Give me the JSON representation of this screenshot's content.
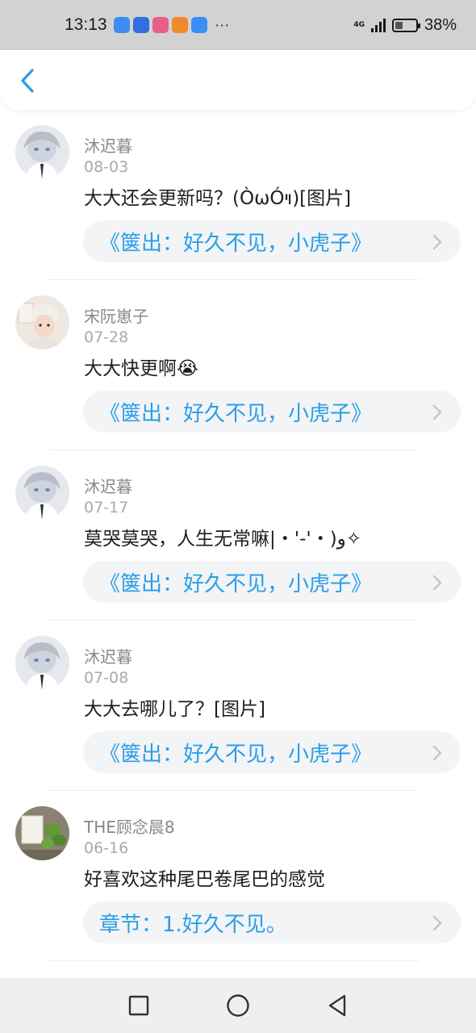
{
  "status_bar": {
    "time": "13:13",
    "more": "···",
    "network": "4G",
    "battery": "38%",
    "battery_level": 0.38,
    "apps": [
      {
        "icon": "shield-app-icon",
        "color": "#3d8ef0"
      },
      {
        "icon": "lightbulb-app-icon",
        "color": "#2f6fe0"
      },
      {
        "icon": "grid-app-icon",
        "color": "#e85d8a"
      },
      {
        "icon": "play-app-icon",
        "color": "#f08a2a"
      },
      {
        "icon": "weather-app-icon",
        "color": "#3a8ff5"
      }
    ]
  },
  "header": {
    "back_icon": "chevron-left-icon",
    "accent_color": "#2a9ee8"
  },
  "comments": [
    {
      "username": "沐迟暮",
      "date": "08-03",
      "text": "大大还会更新吗？(ÒωÓױ)[图片]",
      "link": "《箧出：好久不见，小虎子》",
      "avatar": "anime-boy-avatar"
    },
    {
      "username": "宋阮崽子",
      "date": "07-28",
      "text": "大大快更啊😭",
      "link": "《箧出：好久不见，小虎子》",
      "avatar": "child-photo-avatar"
    },
    {
      "username": "沐迟暮",
      "date": "07-17",
      "text": "莫哭莫哭，人生无常嘛|・'-'・)و✧",
      "link": "《箧出：好久不见，小虎子》",
      "avatar": "anime-boy-avatar"
    },
    {
      "username": "沐迟暮",
      "date": "07-08",
      "text": "大大去哪儿了？[图片]",
      "link": "《箧出：好久不见，小虎子》",
      "avatar": "anime-boy-avatar"
    },
    {
      "username": "THE顾念晨8",
      "date": "06-16",
      "text": "好喜欢这种尾巴卷尾巴的感觉",
      "link": "章节：1.好久不见。",
      "avatar": "plant-photo-avatar"
    }
  ],
  "nav": {
    "recent": "square-icon",
    "home": "circle-icon",
    "back": "triangle-back-icon"
  }
}
